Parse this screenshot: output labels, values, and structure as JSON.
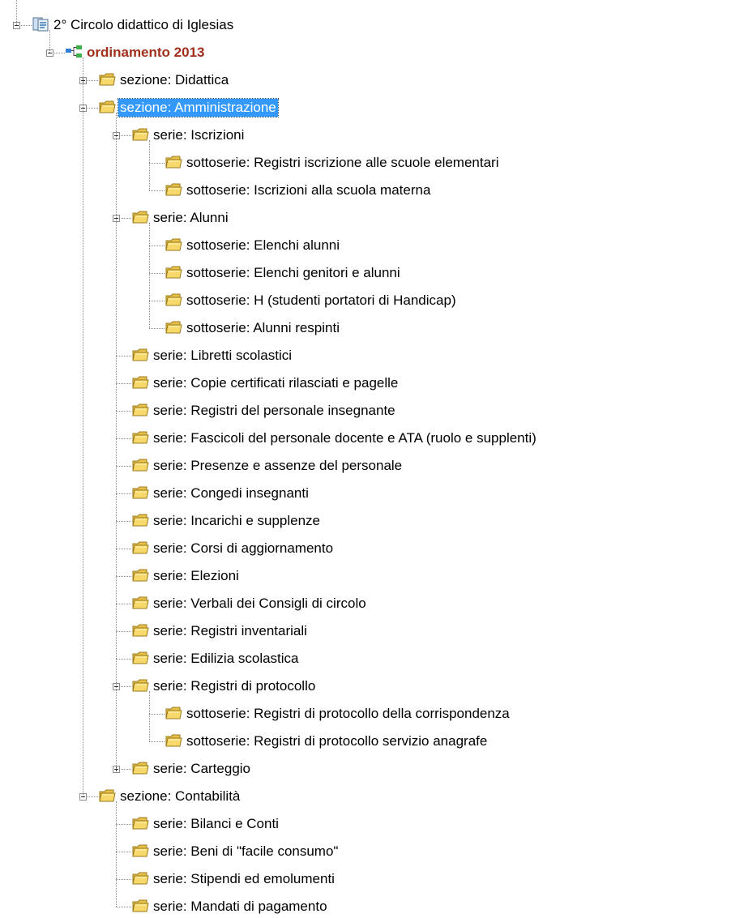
{
  "colors": {
    "selection_bg": "#3399ff",
    "selection_text": "#ffffff",
    "bold_label": "#a0301c",
    "folder_fill": "#f7d96b",
    "connector": "#8a8a8a"
  },
  "tree": {
    "label": "2° Circolo didattico di Iglesias",
    "icon": "archive-icon",
    "expanded": true,
    "children": [
      {
        "label": "ordinamento 2013",
        "icon": "hierarchy-icon",
        "bold": true,
        "expanded": true,
        "children": [
          {
            "label": "sezione: Didattica",
            "icon": "folder-icon",
            "expanded": false,
            "has_children": true
          },
          {
            "label": "sezione: Amministrazione",
            "icon": "folder-icon",
            "selected": true,
            "expanded": true,
            "children": [
              {
                "label": "serie: Iscrizioni",
                "icon": "folder-icon",
                "expanded": true,
                "children": [
                  {
                    "label": "sottoserie: Registri iscrizione alle scuole elementari",
                    "icon": "folder-icon"
                  },
                  {
                    "label": "sottoserie: Iscrizioni alla scuola materna",
                    "icon": "folder-icon"
                  }
                ]
              },
              {
                "label": "serie: Alunni",
                "icon": "folder-icon",
                "expanded": true,
                "children": [
                  {
                    "label": "sottoserie: Elenchi alunni",
                    "icon": "folder-icon"
                  },
                  {
                    "label": "sottoserie: Elenchi genitori e alunni",
                    "icon": "folder-icon"
                  },
                  {
                    "label": "sottoserie: H (studenti portatori di Handicap)",
                    "icon": "folder-icon"
                  },
                  {
                    "label": "sottoserie: Alunni respinti",
                    "icon": "folder-icon"
                  }
                ]
              },
              {
                "label": "serie: Libretti scolastici",
                "icon": "folder-icon"
              },
              {
                "label": "serie: Copie certificati rilasciati e pagelle",
                "icon": "folder-icon"
              },
              {
                "label": "serie: Registri del personale insegnante",
                "icon": "folder-icon"
              },
              {
                "label": "serie: Fascicoli del personale docente e ATA (ruolo e supplenti)",
                "icon": "folder-icon"
              },
              {
                "label": "serie: Presenze e assenze del personale",
                "icon": "folder-icon"
              },
              {
                "label": "serie: Congedi insegnanti",
                "icon": "folder-icon"
              },
              {
                "label": "serie: Incarichi e supplenze",
                "icon": "folder-icon"
              },
              {
                "label": "serie: Corsi di aggiornamento",
                "icon": "folder-icon"
              },
              {
                "label": "serie: Elezioni",
                "icon": "folder-icon"
              },
              {
                "label": "serie: Verbali dei Consigli di circolo",
                "icon": "folder-icon"
              },
              {
                "label": "serie: Registri inventariali",
                "icon": "folder-icon"
              },
              {
                "label": "serie: Edilizia scolastica",
                "icon": "folder-icon"
              },
              {
                "label": "serie: Registri di protocollo",
                "icon": "folder-icon",
                "expanded": true,
                "children": [
                  {
                    "label": "sottoserie: Registri di protocollo della corrispondenza",
                    "icon": "folder-icon"
                  },
                  {
                    "label": "sottoserie: Registri di protocollo servizio anagrafe",
                    "icon": "folder-icon"
                  }
                ]
              },
              {
                "label": "serie: Carteggio",
                "icon": "folder-icon",
                "expanded": false,
                "has_children": true
              }
            ]
          },
          {
            "label": "sezione: Contabilità",
            "icon": "folder-icon",
            "expanded": true,
            "children": [
              {
                "label": "serie: Bilanci e Conti",
                "icon": "folder-icon"
              },
              {
                "label": "serie: Beni di  \"facile consumo\"",
                "icon": "folder-icon"
              },
              {
                "label": "serie: Stipendi ed emolumenti",
                "icon": "folder-icon"
              },
              {
                "label": "serie: Mandati di pagamento",
                "icon": "folder-icon"
              }
            ]
          }
        ]
      }
    ]
  }
}
